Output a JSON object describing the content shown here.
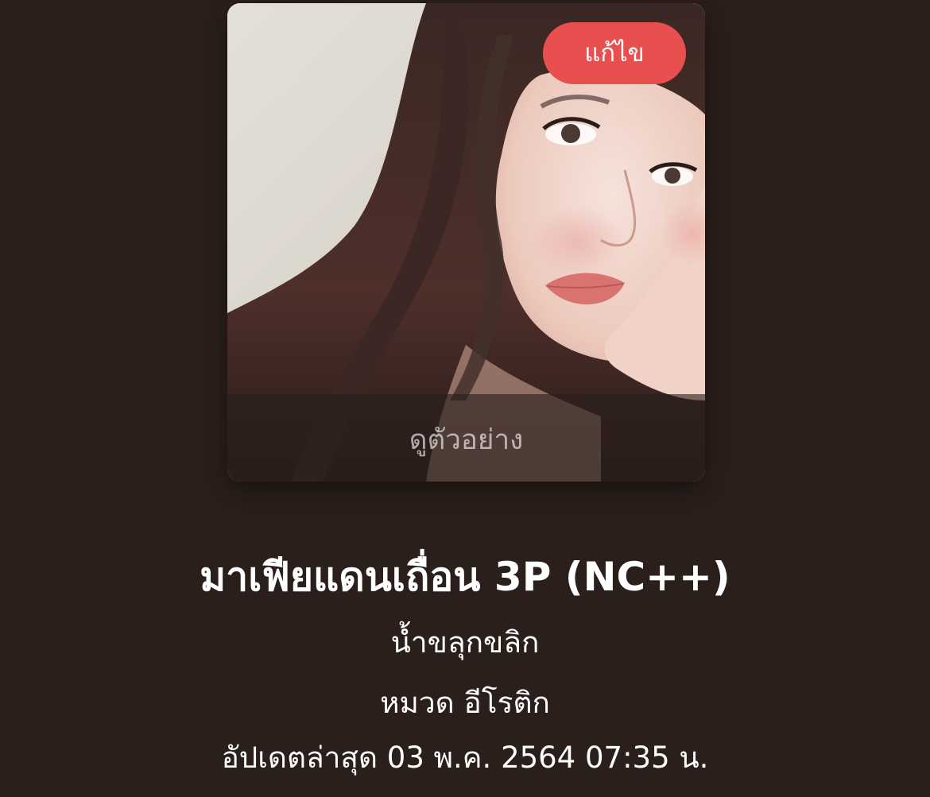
{
  "cover": {
    "edit_label": "แก้ไข",
    "preview_label": "ดูตัวอย่าง"
  },
  "story": {
    "title": "มาเฟียแดนเถื่อน 3P (NC++)",
    "author": "น้ำขลุกขลิก",
    "category": "หมวด อีโรติก",
    "updated": "อัปเดตล่าสุด 03 พ.ค. 2564 07:35 น."
  },
  "colors": {
    "background": "#2b1f1b",
    "accent": "#e84f4f",
    "text": "#ffffff"
  }
}
